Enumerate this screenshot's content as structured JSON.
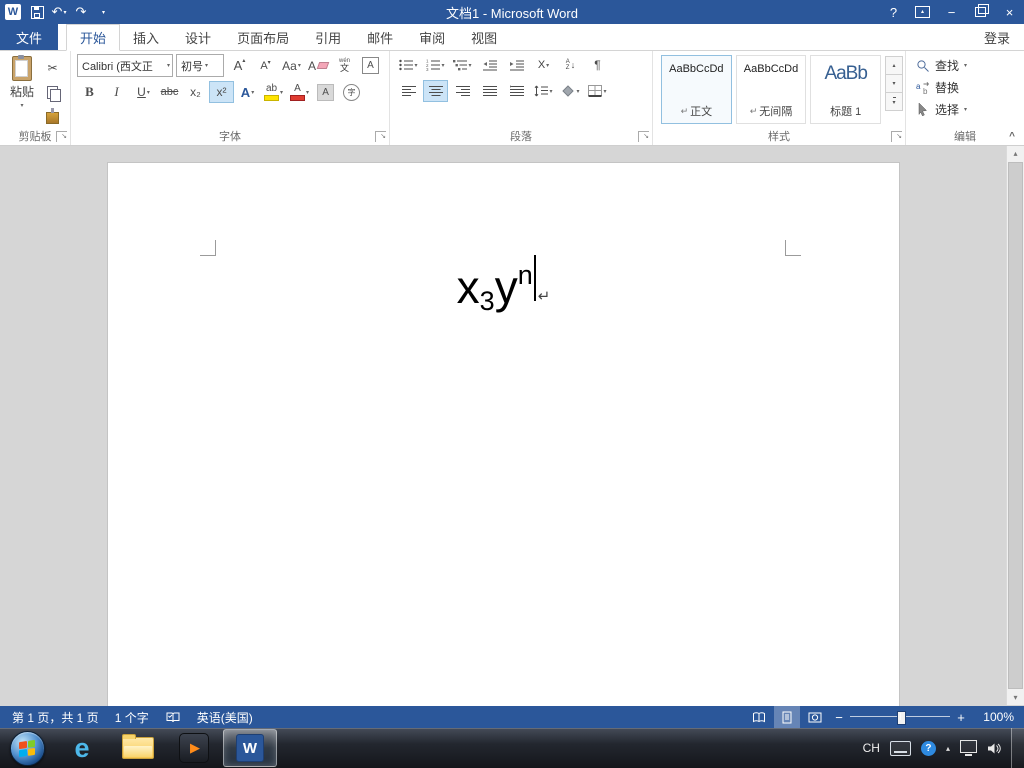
{
  "title_bar": {
    "title": "文档1 - Microsoft Word"
  },
  "icons": {
    "word_logo": "W",
    "undo": "↶",
    "redo": "↷",
    "qat_more": "▾",
    "dropdown": "▾",
    "up_small": "▴",
    "help": "?",
    "minimize": "−",
    "close": "×",
    "scissors": "✂",
    "pilcrow": "¶",
    "down_arrow": "↓",
    "launcher": "↘",
    "collapse": "^",
    "play": "▶",
    "ie_logo": "e",
    "question": "?"
  },
  "ribbon": {
    "file_tab": "文件",
    "tabs": [
      {
        "label": "开始"
      },
      {
        "label": "插入"
      },
      {
        "label": "设计"
      },
      {
        "label": "页面布局"
      },
      {
        "label": "引用"
      },
      {
        "label": "邮件"
      },
      {
        "label": "审阅"
      },
      {
        "label": "视图"
      }
    ],
    "sign_in": "登录",
    "clipboard": {
      "label": "剪贴板",
      "paste": "粘贴"
    },
    "font": {
      "label": "字体",
      "name": "Calibri (西文正",
      "size": "初号",
      "grow": "A",
      "shrink": "A",
      "change_case": "Aa",
      "clear_format": "A",
      "pinyin_top": "wén",
      "pinyin_bottom": "文",
      "char_border": "A",
      "bold": "B",
      "italic": "I",
      "underline": "U",
      "strike": "abc",
      "subscript": "x₂",
      "superscript": "x²",
      "text_effects": "A",
      "highlight": "ab",
      "font_color": "A",
      "char_shading": "A",
      "enclose": "字"
    },
    "paragraph": {
      "label": "段落",
      "asian_layout": "X",
      "sort_a": "A",
      "sort_z": "Z"
    },
    "styles": {
      "label": "样式",
      "items": [
        {
          "preview": "AaBbCcDd",
          "marker": "↵",
          "name": "正文"
        },
        {
          "preview": "AaBbCcDd",
          "marker": "↵",
          "name": "无间隔"
        },
        {
          "preview": "AaBb",
          "marker": "",
          "name": "标题 1"
        }
      ]
    },
    "editing": {
      "label": "编辑",
      "find": "查找",
      "replace": "替换",
      "select": "选择"
    }
  },
  "document": {
    "base1": "x",
    "subscript": "3",
    "base2": "y",
    "superscript": "n",
    "paragraph_mark": "↵"
  },
  "status_bar": {
    "page_info": "第 1 页，共 1 页",
    "word_count": "1 个字",
    "language": "英语(美国)",
    "zoom_out": "−",
    "zoom_in": "+",
    "zoom_level": "100%"
  },
  "taskbar": {
    "ime": "CH"
  }
}
